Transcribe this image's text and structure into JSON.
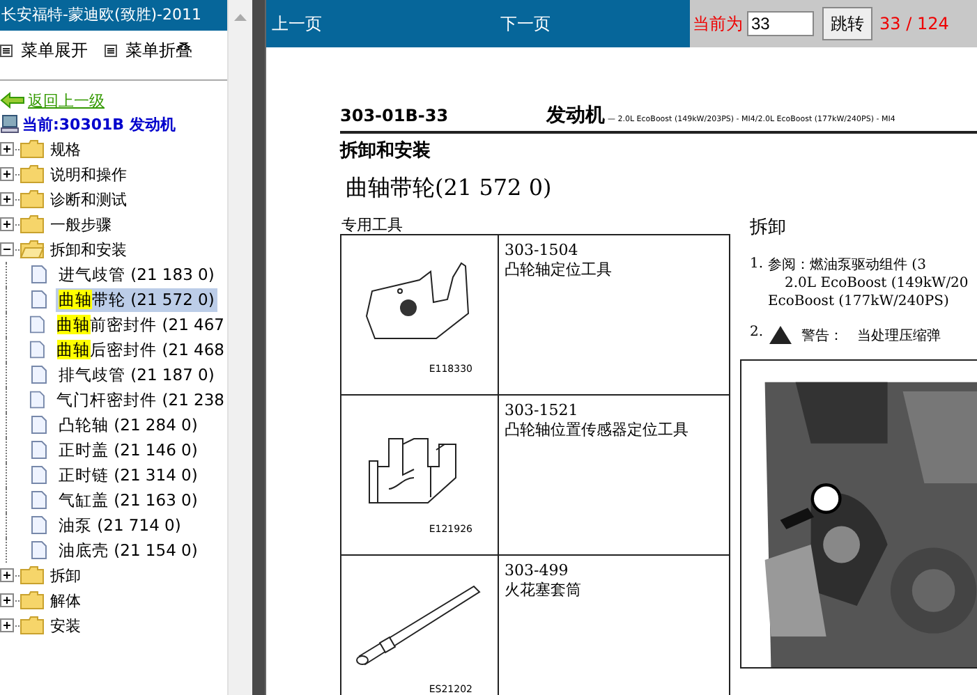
{
  "sidebar": {
    "title": "长安福特-蒙迪欧(致胜)-2011",
    "actions": [
      "菜单展开",
      "菜单折叠"
    ],
    "back_link": "返回上一级",
    "current": "当前:30301B 发动机",
    "tree": [
      {
        "label": "规格",
        "expanded": false
      },
      {
        "label": "说明和操作",
        "expanded": false
      },
      {
        "label": "诊断和测试",
        "expanded": false
      },
      {
        "label": "一般步骤",
        "expanded": false
      },
      {
        "label": "拆卸和安装",
        "expanded": true,
        "children": [
          {
            "label": "进气歧管 (21 183 0)",
            "selected": false
          },
          {
            "match": "曲轴",
            "label": "带轮 (21 572 0)",
            "selected": true
          },
          {
            "match": "曲轴",
            "label": "前密封件 (21 467",
            "selected": false
          },
          {
            "match": "曲轴",
            "label": "后密封件 (21 468",
            "selected": false
          },
          {
            "label": "排气歧管 (21 187 0)",
            "selected": false
          },
          {
            "label": "气门杆密封件 (21 238",
            "selected": false
          },
          {
            "label": "凸轮轴 (21 284 0)",
            "selected": false
          },
          {
            "label": "正时盖 (21 146 0)",
            "selected": false
          },
          {
            "label": "正时链 (21 314 0)",
            "selected": false
          },
          {
            "label": "气缸盖 (21 163 0)",
            "selected": false
          },
          {
            "label": "油泵 (21 714 0)",
            "selected": false
          },
          {
            "label": "油底壳 (21 154 0)",
            "selected": false
          }
        ]
      },
      {
        "label": "拆卸",
        "expanded": false
      },
      {
        "label": "解体",
        "expanded": false
      },
      {
        "label": "安装",
        "expanded": false
      }
    ]
  },
  "toolbar": {
    "prev": "上一页",
    "next": "下一页",
    "current_label": "当前为",
    "page_input": "33",
    "jump_button": "跳转",
    "page_count": "33 / 124"
  },
  "document": {
    "code": "303-01B-33",
    "header_title": "发动机",
    "header_subtitle": "— 2.0L EcoBoost (149kW/203PS) - MI4/2.0L EcoBoost (177kW/240PS) - MI4",
    "section": "拆卸和安装",
    "title": "曲轴带轮(21 572 0)",
    "tools_caption": "专用工具",
    "tools": [
      {
        "kind": "bracket",
        "figure_code": "E118330",
        "number": "303-1504",
        "name": "凸轮轴定位工具"
      },
      {
        "kind": "block",
        "figure_code": "E121926",
        "number": "303-1521",
        "name": "凸轮轴位置传感器定位工具"
      },
      {
        "kind": "socket",
        "figure_code": "ES21202",
        "number": "303-499",
        "name": "火花塞套筒"
      }
    ],
    "removal_heading": "拆卸",
    "steps": [
      {
        "kind": "text",
        "number": "1.",
        "lines": [
          "参阅：燃油泵驱动组件 (3",
          "2.0L EcoBoost (149kW/20",
          "EcoBoost (177kW/240PS)"
        ]
      },
      {
        "kind": "warning",
        "number": "2.",
        "label": "警告：",
        "lines": [
          "当处理压缩弹"
        ]
      }
    ]
  }
}
